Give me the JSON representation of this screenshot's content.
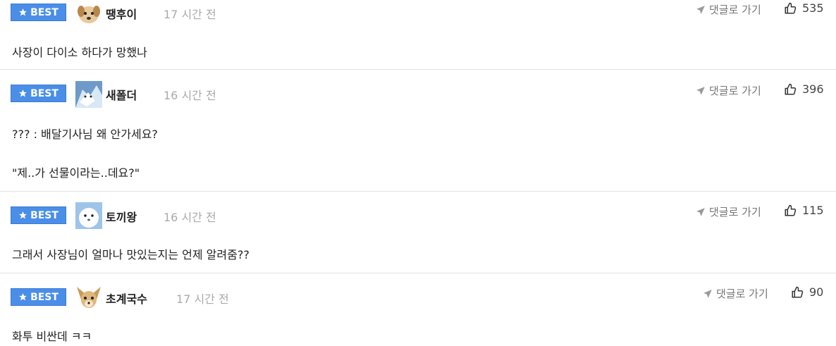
{
  "comments": [
    {
      "badge": "BEST",
      "nick": "땡후이",
      "time": "17 시간 전",
      "reply": "댓글로 가기",
      "likes": "535",
      "lines": [
        "사장이 다이소 하다가 망했나"
      ],
      "avatar": "puppy-avatar"
    },
    {
      "badge": "BEST",
      "nick": "새폴더",
      "time": "16 시간 전",
      "reply": "댓글로 가기",
      "likes": "396",
      "lines": [
        "??? : 배달기사님 왜 안가세요?",
        "\"제..가 선물이라는..데요?\""
      ],
      "avatar": "ice-avatar"
    },
    {
      "badge": "BEST",
      "nick": "토끼왕",
      "time": "16 시간 전",
      "reply": "댓글로 가기",
      "likes": "115",
      "lines": [
        "그래서 사장님이 얼마나 맛있는지는 언제 알려줌??"
      ],
      "avatar": "white-animal-avatar"
    },
    {
      "badge": "BEST",
      "nick": "초계국수",
      "time": "17 시간 전",
      "reply": "댓글로 가기",
      "likes": "90",
      "lines": [
        "화투 비싼데 ㅋㅋ"
      ],
      "avatar": "chihuahua-avatar"
    }
  ],
  "colors": {
    "badge": "#4a8ee8",
    "time": "#aaaaaa",
    "divider": "#e4e4e4"
  },
  "icons": {
    "star": "star-icon",
    "reply": "arrow-icon",
    "like": "thumbs-up-icon"
  }
}
